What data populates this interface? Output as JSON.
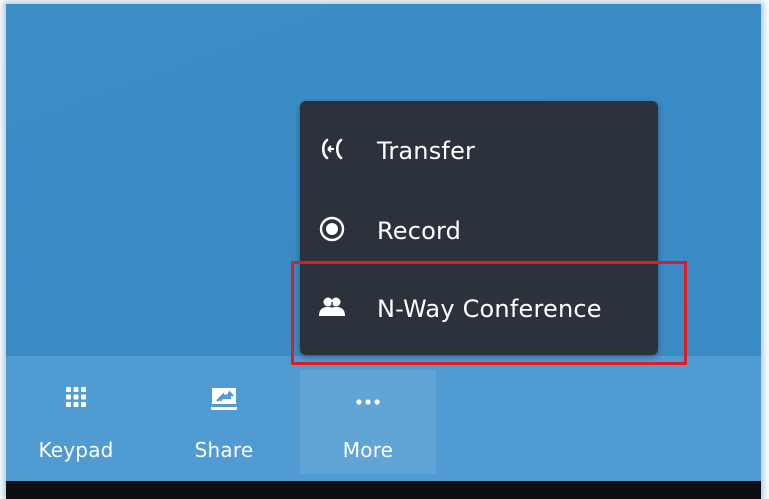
{
  "toolbar": {
    "keypad_label": "Keypad",
    "share_label": "Share",
    "more_label": "More"
  },
  "menu": {
    "items": [
      {
        "label": "Transfer",
        "icon": "transfer-icon"
      },
      {
        "label": "Record",
        "icon": "record-icon"
      },
      {
        "label": "N-Way Conference",
        "icon": "conference-icon"
      }
    ]
  },
  "highlight": {
    "target": "N-Way Conference",
    "color": "#e01b22"
  },
  "colors": {
    "call_background": "#3b8bc5",
    "toolbar_background": "#4f9bd2",
    "menu_background": "#2c323b",
    "text": "#ffffff"
  }
}
